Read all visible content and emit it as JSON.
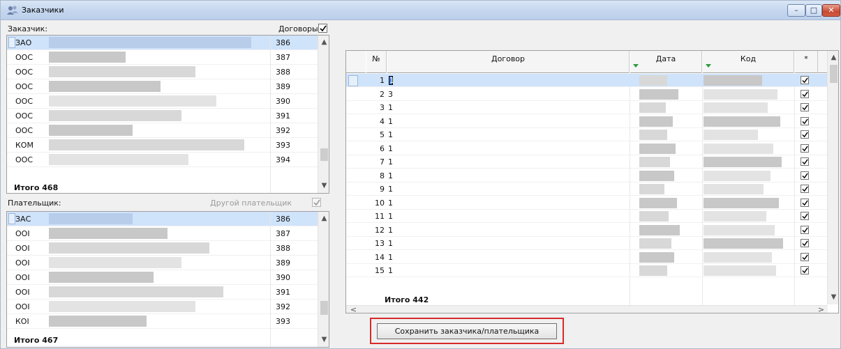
{
  "window": {
    "title": "Заказчики",
    "minimize_glyph": "–",
    "maximize_glyph": "□",
    "close_glyph": "✕"
  },
  "customers": {
    "label": "Заказчик:",
    "contracts_label": "Договоры",
    "contracts_checked": true,
    "rows": [
      {
        "name": "ЗАО",
        "num": "386",
        "selected": true
      },
      {
        "name": "ООС",
        "num": "387"
      },
      {
        "name": "ООС",
        "num": "388"
      },
      {
        "name": "ООС",
        "num": "389"
      },
      {
        "name": "ООС",
        "num": "390"
      },
      {
        "name": "ООС",
        "num": "391"
      },
      {
        "name": "ООС",
        "num": "392"
      },
      {
        "name": "КОМ",
        "num": "393"
      },
      {
        "name": "ООС",
        "num": "394"
      }
    ],
    "total": "Итого 468"
  },
  "payers": {
    "label": "Плательщик:",
    "other_payer_label": "Другой плательщик",
    "other_payer_checked": true,
    "rows": [
      {
        "name": "ЗАС",
        "num": "386",
        "selected": true
      },
      {
        "name": "ООІ",
        "num": "387"
      },
      {
        "name": "ООІ",
        "num": "388"
      },
      {
        "name": "ООІ",
        "num": "389"
      },
      {
        "name": "ООІ",
        "num": "390"
      },
      {
        "name": "ООІ",
        "num": "391"
      },
      {
        "name": "ООІ",
        "num": "392"
      },
      {
        "name": "КОІ",
        "num": "393"
      }
    ],
    "total": "Итого 467"
  },
  "contracts": {
    "columns": {
      "num": "№",
      "contract": "Договор",
      "date": "Дата",
      "code": "Код",
      "flag": "*"
    },
    "rows": [
      {
        "num": "1",
        "contract": "1",
        "checked": true,
        "selected": true
      },
      {
        "num": "2",
        "contract": "3",
        "checked": true
      },
      {
        "num": "3",
        "contract": "1",
        "checked": true
      },
      {
        "num": "4",
        "contract": "1",
        "checked": true
      },
      {
        "num": "5",
        "contract": "1",
        "checked": true
      },
      {
        "num": "6",
        "contract": "1",
        "checked": true
      },
      {
        "num": "7",
        "contract": "1",
        "checked": true
      },
      {
        "num": "8",
        "contract": "1",
        "checked": true
      },
      {
        "num": "9",
        "contract": "1",
        "checked": true
      },
      {
        "num": "10",
        "contract": "1",
        "checked": true
      },
      {
        "num": "11",
        "contract": "1",
        "checked": true
      },
      {
        "num": "12",
        "contract": "1",
        "checked": true
      },
      {
        "num": "13",
        "contract": "1",
        "checked": true
      },
      {
        "num": "14",
        "contract": "1",
        "checked": true
      },
      {
        "num": "15",
        "contract": "1",
        "checked": true
      }
    ],
    "total": "Итого 442"
  },
  "save_button": {
    "label": "Сохранить заказчика/плательщика"
  },
  "icons": {
    "app": "users-icon",
    "scroll_up": "▲",
    "scroll_down": "▼",
    "scroll_left": "<",
    "scroll_right": ">"
  },
  "colors": {
    "selection": "#cfe3fb",
    "highlight_border": "#d72a2a",
    "sort_marker": "#2e9a3e"
  }
}
